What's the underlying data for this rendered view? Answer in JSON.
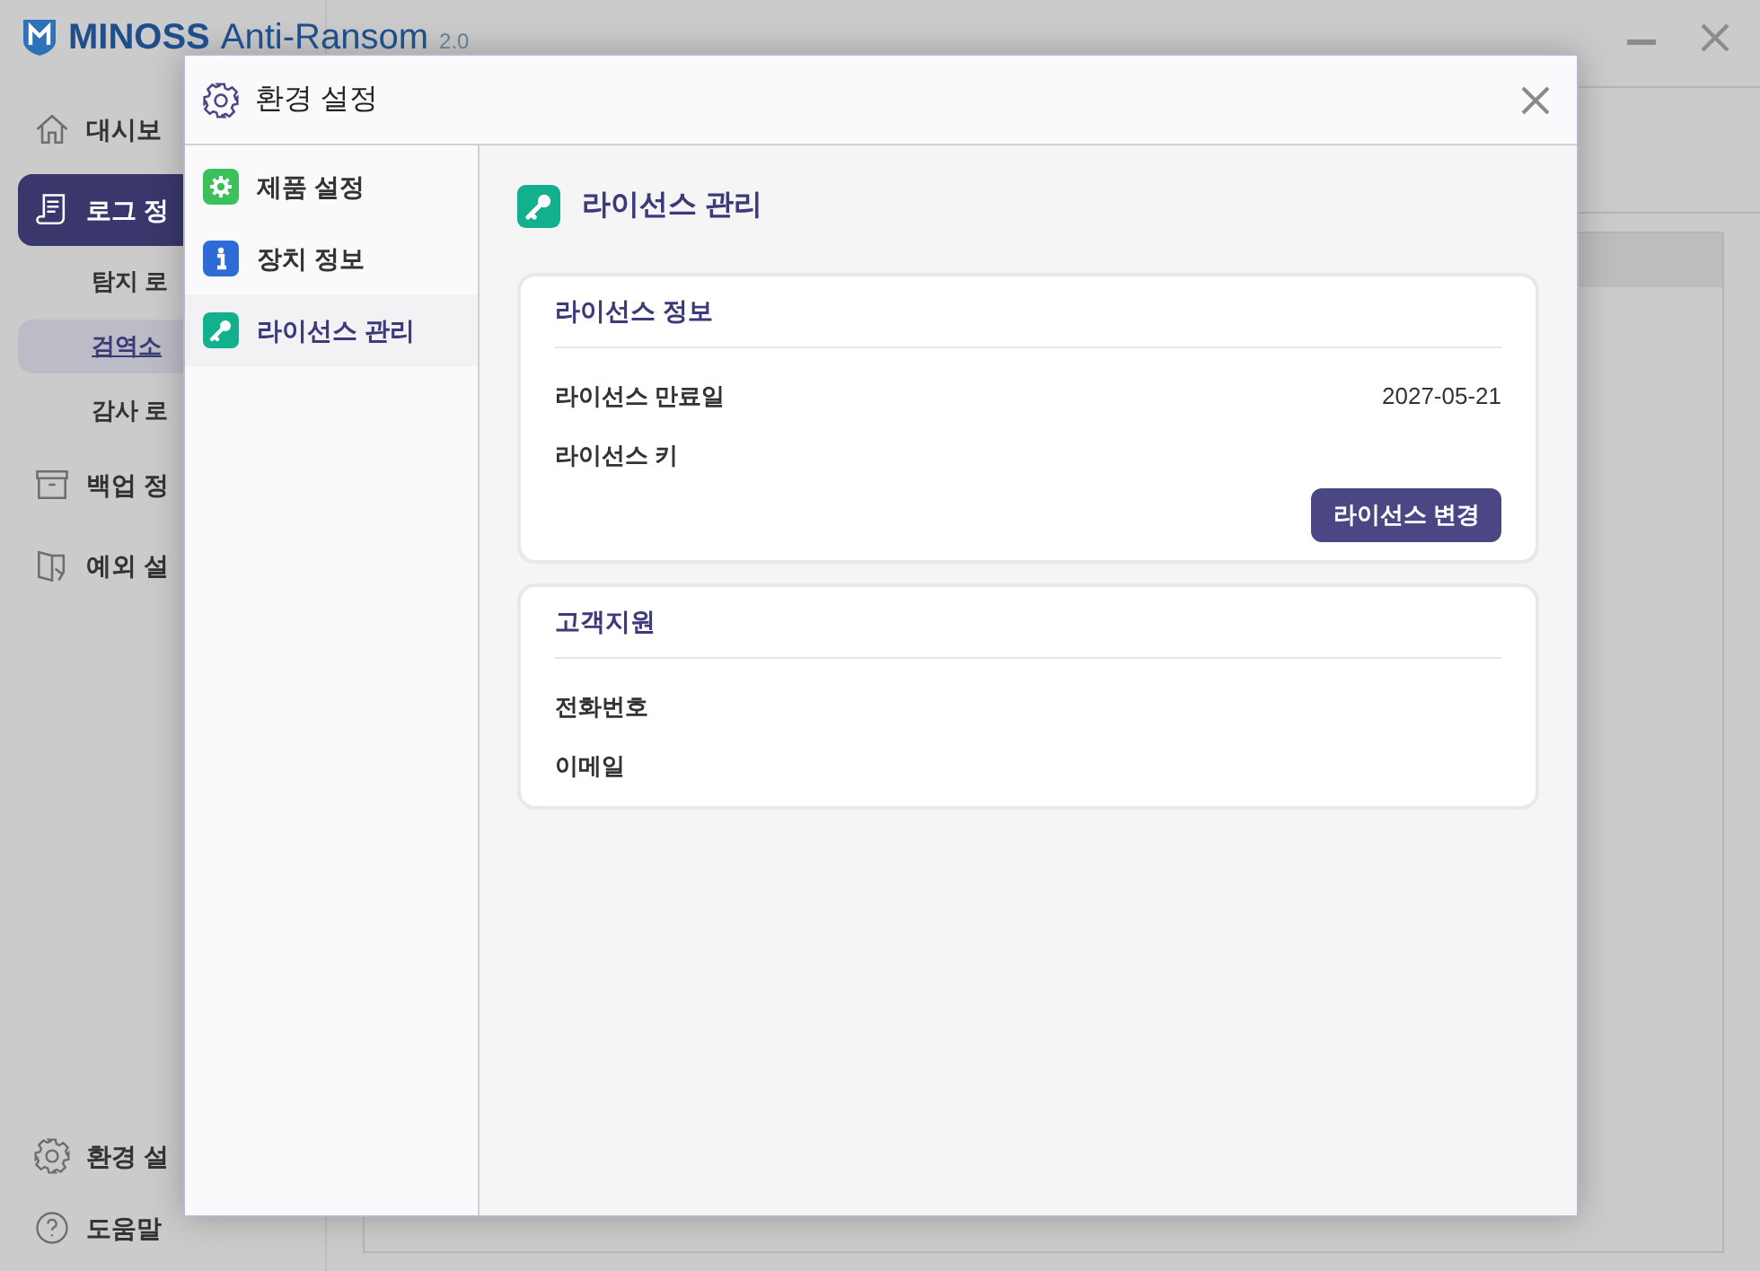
{
  "app": {
    "logo": "MINOSS",
    "title": "Anti-Ransom",
    "version": "2.0",
    "sidebar": [
      {
        "kind": "home",
        "label": "대시보",
        "selected": false
      },
      {
        "kind": "scroll",
        "label": "로그 정",
        "selected": true,
        "children": [
          {
            "label": "탐지 로",
            "selected": false
          },
          {
            "label": "검역소",
            "selected": true
          },
          {
            "label": "감사 로",
            "selected": false
          }
        ]
      },
      {
        "kind": "box",
        "label": "백업 정",
        "selected": false
      },
      {
        "kind": "folder",
        "label": "예외 설",
        "selected": false
      }
    ],
    "bottom": [
      {
        "kind": "gear",
        "label": "환경 설"
      },
      {
        "kind": "help",
        "label": "도움말"
      }
    ]
  },
  "dialog": {
    "title": "환경 설정",
    "nav": [
      {
        "kind": "gear",
        "color": "#3cc05a",
        "label": "제품 설정",
        "selected": false
      },
      {
        "kind": "info",
        "color": "#2e6bd6",
        "label": "장치 정보",
        "selected": false
      },
      {
        "kind": "key",
        "color": "#13b08d",
        "label": "라이선스 관리",
        "selected": true
      }
    ],
    "section_title": "라이선스 관리",
    "cards": [
      {
        "title": "라이선스 정보",
        "rows": [
          {
            "label": "라이선스 만료일",
            "value": "2027-05-21"
          },
          {
            "label": "라이선스 키"
          }
        ],
        "button": "라이선스 변경"
      },
      {
        "title": "고객지원",
        "rows": [
          {
            "label": "전화번호"
          },
          {
            "label": "이메일"
          }
        ]
      }
    ]
  }
}
